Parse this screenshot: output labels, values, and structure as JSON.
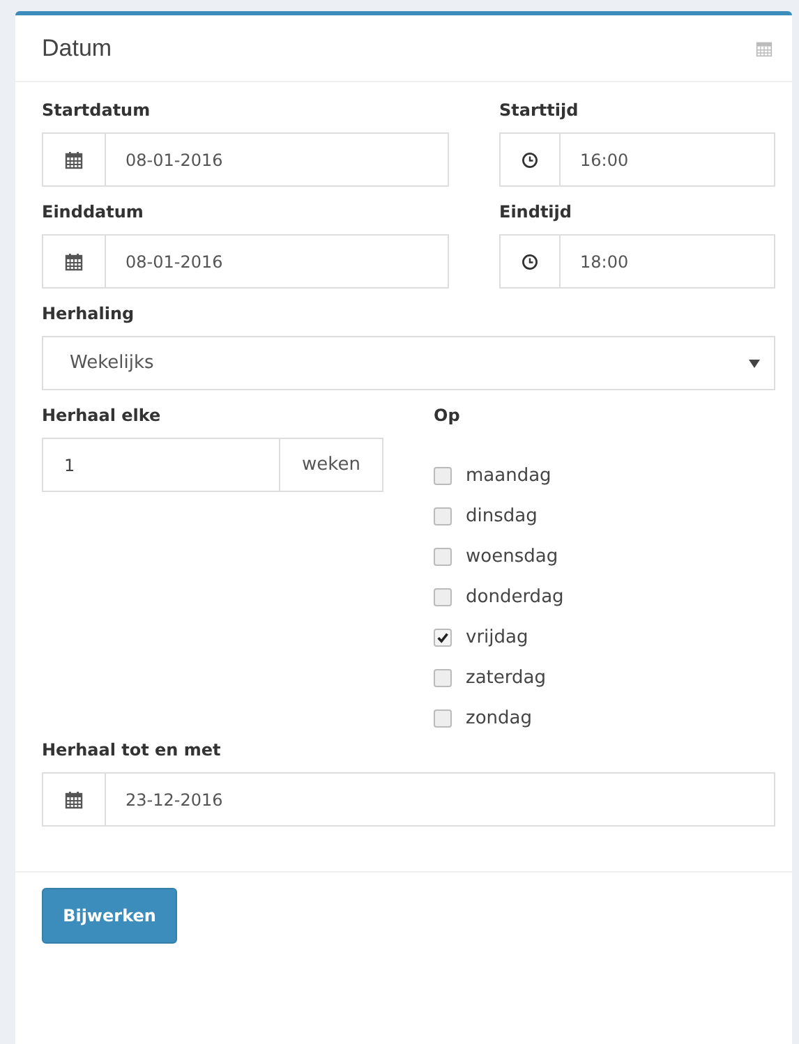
{
  "panel": {
    "title": "Datum"
  },
  "datetime_rows": [
    [
      {
        "label": "Startdatum",
        "value": "08-01-2016",
        "kind": "date"
      },
      {
        "label": "Starttijd",
        "value": "16:00",
        "kind": "time"
      }
    ],
    [
      {
        "label": "Einddatum",
        "value": "08-01-2016",
        "kind": "date"
      },
      {
        "label": "Eindtijd",
        "value": "18:00",
        "kind": "time"
      }
    ]
  ],
  "repeat": {
    "label": "Herhaling",
    "value": "Wekelijks"
  },
  "interval": {
    "label": "Herhaal elke",
    "value": "1",
    "unit": "weken"
  },
  "days": {
    "label": "Op",
    "items": [
      {
        "label": "maandag",
        "checked": false
      },
      {
        "label": "dinsdag",
        "checked": false
      },
      {
        "label": "woensdag",
        "checked": false
      },
      {
        "label": "donderdag",
        "checked": false
      },
      {
        "label": "vrijdag",
        "checked": true
      },
      {
        "label": "zaterdag",
        "checked": false
      },
      {
        "label": "zondag",
        "checked": false
      }
    ]
  },
  "until": {
    "label": "Herhaal tot en met",
    "value": "23-12-2016"
  },
  "button": "Bijwerken"
}
